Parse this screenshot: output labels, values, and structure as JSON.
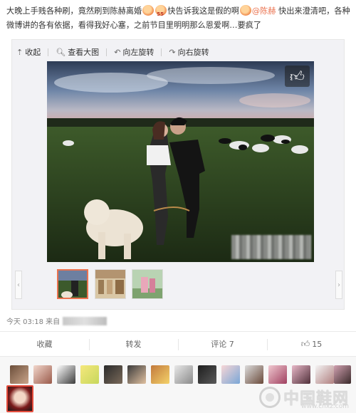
{
  "post": {
    "text_part1": "大晚上手贱各种刷，竟然刷到陈赫离婚",
    "text_part2": "快告诉我这是假的啊",
    "mention": "@陈赫",
    "text_part3": "快出来澄清吧，各种微博讲的各有依据，看得我好心塞，之前节目里明明那么恩爱啊…要疯了"
  },
  "toolbar": {
    "collapse": "收起",
    "view_large": "查看大图",
    "rotate_left": "向左旋转",
    "rotate_right": "向右旋转"
  },
  "icons": {
    "collapse": "collapse-arrow-icon",
    "view_large": "magnifier-icon",
    "rotate_left": "rotate-left-icon",
    "rotate_right": "rotate-right-icon",
    "like_overlay": "thumbs-up-icon",
    "like_action": "thumbs-up-icon"
  },
  "meta": {
    "time": "今天 03:18 来自"
  },
  "actions": {
    "favorite": "收藏",
    "repost": "转发",
    "comment": "评论 7",
    "like_count": "15"
  },
  "watermark": {
    "brand": "中国鞋网",
    "url": "www.cnxz.com"
  },
  "colors": {
    "accent": "#eb7350",
    "mention": "#eb7350",
    "border": "#e6e6e6"
  }
}
